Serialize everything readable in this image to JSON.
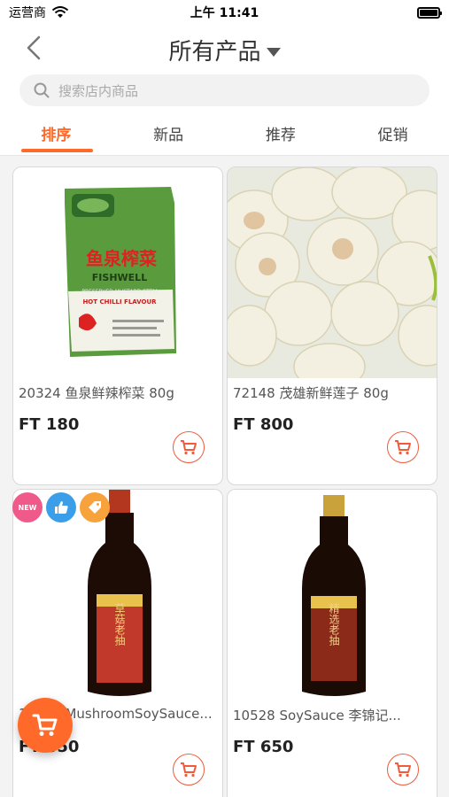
{
  "status": {
    "carrier": "运营商",
    "time": "上午 11:41"
  },
  "header": {
    "title": "所有产品"
  },
  "search": {
    "placeholder": "搜索店内商品"
  },
  "tabs": [
    {
      "label": "排序",
      "active": true
    },
    {
      "label": "新品",
      "active": false
    },
    {
      "label": "推荐",
      "active": false
    },
    {
      "label": "促销",
      "active": false
    }
  ],
  "products": [
    {
      "name": "20324 鱼泉鲜辣榨菜 80g",
      "price": "FT 180",
      "image": "fishwell-mustard-pack",
      "package_brand": "鱼泉榨菜",
      "package_brand_en": "FISHWELL",
      "package_sub": "PRESERVED MUSTARD STEM",
      "package_flavour": "HOT CHILLI FLAVOUR"
    },
    {
      "name": "72148 茂雄新鲜莲子 80g",
      "price": "FT 800",
      "image": "lotus-seeds"
    },
    {
      "name": "10526 MushroomSoySauce...",
      "price": "FT 650",
      "image": "mushroom-soy-sauce-bottle",
      "label_text": "草菇老抽"
    },
    {
      "name": "10528 SoySauce 李锦记...",
      "price": "FT 650",
      "image": "soy-sauce-bottle",
      "label_text": "精选老抽"
    }
  ],
  "badges": {
    "new": "NEW",
    "icons": [
      "new-badge",
      "thumbs-up-icon",
      "tag-icon"
    ]
  },
  "colors": {
    "accent": "#ff6a2a",
    "cart": "#f15a3a"
  }
}
